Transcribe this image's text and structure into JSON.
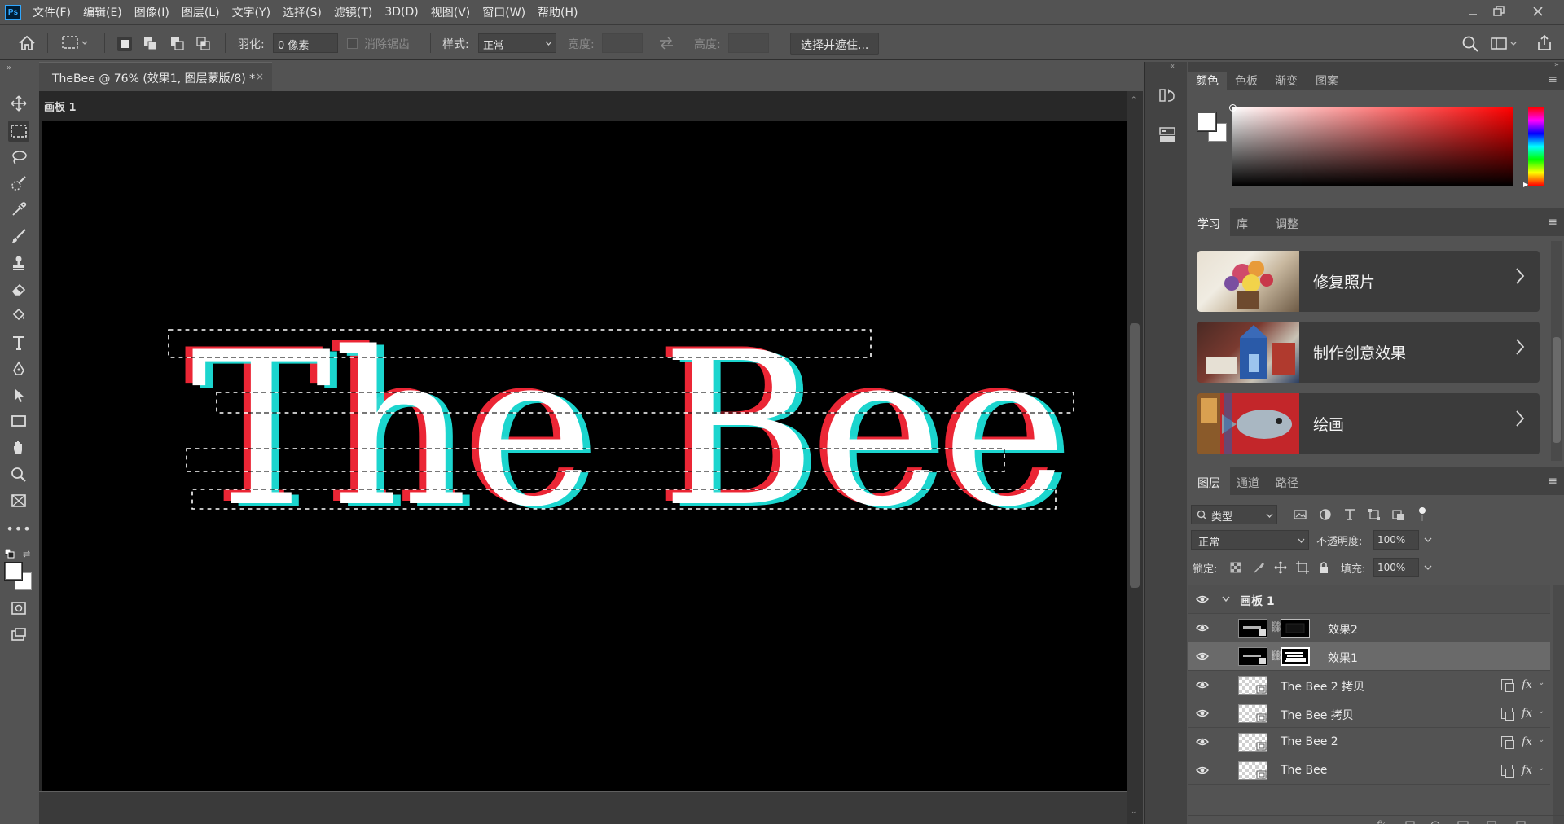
{
  "app": {
    "logo": "Ps"
  },
  "menu": [
    "文件(F)",
    "编辑(E)",
    "图像(I)",
    "图层(L)",
    "文字(Y)",
    "选择(S)",
    "滤镜(T)",
    "3D(D)",
    "视图(V)",
    "窗口(W)",
    "帮助(H)"
  ],
  "window_controls": {
    "minimize_icon": "minimize-icon",
    "restore_icon": "restore-icon",
    "close_icon": "close-icon"
  },
  "options": {
    "feather_label": "羽化:",
    "feather_value": "0 像素",
    "antialias_label": "消除锯齿",
    "style_label": "样式:",
    "style_value": "正常",
    "width_label": "宽度:",
    "height_label": "高度:",
    "select_mask_button": "选择并遮住..."
  },
  "document": {
    "tab_title": "TheBee @ 76% (效果1, 图层蒙版/8) *",
    "artboard_label": "画板 1",
    "canvas_text": "The Bee",
    "colors": {
      "red_offset": "#ff2a3a",
      "cyan_offset": "#1ee8e0",
      "fill": "#ffffff",
      "background": "#000000"
    }
  },
  "color_panel": {
    "tabs": [
      "颜色",
      "色板",
      "渐变",
      "图案"
    ],
    "active_tab": "颜色",
    "hue_colors": [
      "#ff0000",
      "#ff00ff",
      "#0000ff",
      "#00ffff",
      "#00ff00",
      "#ffff00",
      "#ff0000"
    ]
  },
  "learn_panel": {
    "tabs": [
      "学习",
      "库",
      "调整"
    ],
    "active_tab": "学习",
    "cards": [
      {
        "title": "修复照片",
        "icon": "chevron-right-icon"
      },
      {
        "title": "制作创意效果",
        "icon": "chevron-right-icon"
      },
      {
        "title": "绘画",
        "icon": "chevron-right-icon"
      }
    ]
  },
  "layers_panel": {
    "tabs": [
      "图层",
      "通道",
      "路径"
    ],
    "active_tab": "图层",
    "filter_label": "类型",
    "blend_mode": "正常",
    "opacity_label": "不透明度:",
    "opacity_value": "100%",
    "lock_label": "锁定:",
    "fill_label": "填充:",
    "fill_value": "100%",
    "group_name": "画板 1",
    "layers": [
      {
        "name": "效果2",
        "type": "masked"
      },
      {
        "name": "效果1",
        "type": "masked",
        "selected": true
      },
      {
        "name": "The Bee 2 拷贝",
        "type": "smart",
        "fx": "fx"
      },
      {
        "name": "The Bee 拷贝",
        "type": "smart",
        "fx": "fx"
      },
      {
        "name": "The Bee 2",
        "type": "smart",
        "fx": "fx"
      },
      {
        "name": "The Bee",
        "type": "smart",
        "fx": "fx"
      }
    ]
  }
}
